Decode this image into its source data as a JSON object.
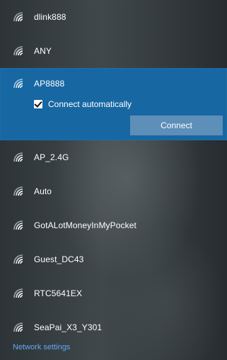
{
  "networks": [
    {
      "name": "dlink888",
      "icon": "wifi-icon"
    },
    {
      "name": "ANY",
      "icon": "wifi-icon"
    },
    {
      "name": "AP8888",
      "icon": "wifi-icon",
      "selected": true,
      "connect_automatically": true,
      "connect_auto_label": "Connect automatically",
      "connect_label": "Connect"
    },
    {
      "name": "AP_2.4G",
      "icon": "wifi-icon"
    },
    {
      "name": "Auto",
      "icon": "wifi-icon"
    },
    {
      "name": "GotALotMoneyInMyPocket",
      "icon": "wifi-icon"
    },
    {
      "name": "Guest_DC43",
      "icon": "wifi-icon"
    },
    {
      "name": "RTC5641EX",
      "icon": "wifi-icon"
    },
    {
      "name": "SeaPai_X3_Y301",
      "icon": "wifi-icon"
    }
  ],
  "footer": {
    "network_settings_label": "Network settings"
  },
  "colors": {
    "selected_background": "#1767a3",
    "connect_button": "#5d8fb9",
    "link": "#61a8f1"
  }
}
